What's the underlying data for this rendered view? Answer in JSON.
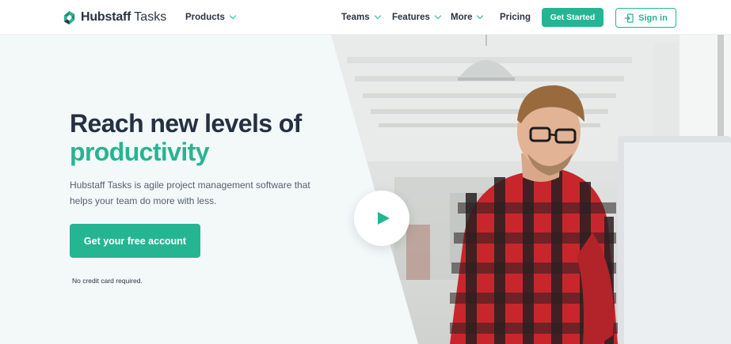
{
  "brand": {
    "name": "Hubstaff",
    "product": "Tasks",
    "logo_icon": "hubstaff-logo-icon",
    "accent_color": "#25b593",
    "text_color": "#253041"
  },
  "nav": {
    "products": "Products",
    "teams": "Teams",
    "features": "Features",
    "more": "More",
    "pricing": "Pricing",
    "get_started": "Get Started",
    "sign_in": "Sign in"
  },
  "hero": {
    "headline_line1": "Reach new levels of",
    "headline_line2": "productivity",
    "subtext": "Hubstaff Tasks is agile project management software that helps your team do more with less.",
    "cta": "Get your free account",
    "note": "No credit card required.",
    "video_button_icon": "play-icon",
    "photo": "man-in-plaid-shirt-at-office-desk-photo"
  }
}
